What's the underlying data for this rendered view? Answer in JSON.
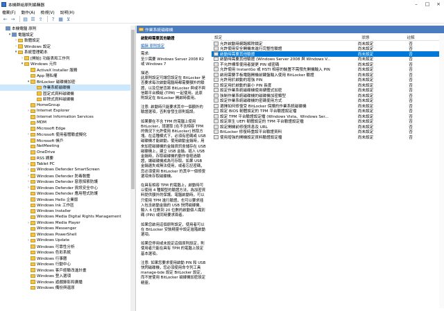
{
  "window": {
    "title": "本機群組原則編輯器"
  },
  "menu": [
    "檔案(F)",
    "動作(A)",
    "檢視(V)",
    "說明(H)"
  ],
  "tree": [
    {
      "label": "本機電腦 原則",
      "indent": 0,
      "icon": "root",
      "twist": ""
    },
    {
      "label": "電腦設定",
      "indent": 1,
      "icon": "root",
      "twist": "▾"
    },
    {
      "label": "軟體設定",
      "indent": 2,
      "icon": "folder",
      "twist": "›"
    },
    {
      "label": "Windows 設定",
      "indent": 2,
      "icon": "folder",
      "twist": "›"
    },
    {
      "label": "系統管理範本",
      "indent": 2,
      "icon": "folder",
      "twist": "▾"
    },
    {
      "label": "[開始] 功能表和工作列",
      "indent": 3,
      "icon": "folder",
      "twist": "›"
    },
    {
      "label": "Windows 元件",
      "indent": 3,
      "icon": "folder",
      "twist": "▾"
    },
    {
      "label": "ActiveX Installer 服務",
      "indent": 4,
      "icon": "folder",
      "twist": ""
    },
    {
      "label": "App 隱私權",
      "indent": 4,
      "icon": "folder",
      "twist": ""
    },
    {
      "label": "BitLocker 磁碟機加密",
      "indent": 4,
      "icon": "folder",
      "twist": "▾"
    },
    {
      "label": "作業系統磁碟機",
      "indent": 5,
      "icon": "folder",
      "twist": "",
      "selected": true
    },
    {
      "label": "固定式資料磁碟機",
      "indent": 5,
      "icon": "folder",
      "twist": ""
    },
    {
      "label": "卸除式資料磁碟機",
      "indent": 5,
      "icon": "folder",
      "twist": ""
    },
    {
      "label": "HomeGroup",
      "indent": 4,
      "icon": "folder",
      "twist": ""
    },
    {
      "label": "Internet Explorer",
      "indent": 4,
      "icon": "folder",
      "twist": "›"
    },
    {
      "label": "Internet Information Services",
      "indent": 4,
      "icon": "folder",
      "twist": ""
    },
    {
      "label": "MDM",
      "indent": 4,
      "icon": "folder",
      "twist": ""
    },
    {
      "label": "Microsoft Edge",
      "indent": 4,
      "icon": "folder",
      "twist": ""
    },
    {
      "label": "Microsoft 使用者體驗虛擬化",
      "indent": 4,
      "icon": "folder",
      "twist": "›"
    },
    {
      "label": "Microsoft 帳戶",
      "indent": 4,
      "icon": "folder",
      "twist": ""
    },
    {
      "label": "NetMeeting",
      "indent": 4,
      "icon": "folder",
      "twist": ""
    },
    {
      "label": "OneDrive",
      "indent": 4,
      "icon": "folder",
      "twist": ""
    },
    {
      "label": "RSS 摘要",
      "indent": 4,
      "icon": "folder",
      "twist": ""
    },
    {
      "label": "Tablet PC",
      "indent": 4,
      "icon": "folder",
      "twist": "›"
    },
    {
      "label": "Windows Defender SmartScreen",
      "indent": 4,
      "icon": "folder",
      "twist": "›"
    },
    {
      "label": "Windows Defender 防毒軟體",
      "indent": 4,
      "icon": "folder",
      "twist": "›"
    },
    {
      "label": "Windows Defender 惡意探索防護",
      "indent": 4,
      "icon": "folder",
      "twist": "›"
    },
    {
      "label": "Windows Defender 資訊安全中心",
      "indent": 4,
      "icon": "folder",
      "twist": "›"
    },
    {
      "label": "Windows Defender 應用程式防護",
      "indent": 4,
      "icon": "folder",
      "twist": ""
    },
    {
      "label": "Windows Hello 企業版",
      "indent": 4,
      "icon": "folder",
      "twist": ""
    },
    {
      "label": "Windows Ink 工作區",
      "indent": 4,
      "icon": "folder",
      "twist": ""
    },
    {
      "label": "Windows Installer",
      "indent": 4,
      "icon": "folder",
      "twist": ""
    },
    {
      "label": "Windows Media Digital Rights Management",
      "indent": 4,
      "icon": "folder",
      "twist": ""
    },
    {
      "label": "Windows Media Player",
      "indent": 4,
      "icon": "folder",
      "twist": "›"
    },
    {
      "label": "Windows Messenger",
      "indent": 4,
      "icon": "folder",
      "twist": ""
    },
    {
      "label": "Windows PowerShell",
      "indent": 4,
      "icon": "folder",
      "twist": ""
    },
    {
      "label": "Windows Update",
      "indent": 4,
      "icon": "folder",
      "twist": "›"
    },
    {
      "label": "Windows 可靠性分析",
      "indent": 4,
      "icon": "folder",
      "twist": ""
    },
    {
      "label": "Windows 色彩系統",
      "indent": 4,
      "icon": "folder",
      "twist": ""
    },
    {
      "label": "Windows 行事曆",
      "indent": 4,
      "icon": "folder",
      "twist": ""
    },
    {
      "label": "Windows 行動中心",
      "indent": 4,
      "icon": "folder",
      "twist": ""
    },
    {
      "label": "Windows 客戶經驗改進計畫",
      "indent": 4,
      "icon": "folder",
      "twist": ""
    },
    {
      "label": "Windows 登入選項",
      "indent": 4,
      "icon": "folder",
      "twist": ""
    },
    {
      "label": "Windows 遊戲錄影和廣播",
      "indent": 4,
      "icon": "folder",
      "twist": ""
    },
    {
      "label": "Windows 備份與還原",
      "indent": 4,
      "icon": "folder",
      "twist": ""
    }
  ],
  "right_header": "作業系統磁碟機",
  "description": {
    "title": "啟動時需要其他驗證",
    "edit_link": "編輯 原則設定",
    "paragraphs": [
      "需求:\n至少需要 Windows Server 2008 R2 或 Windows 7",
      "描述:\n此原則設定可讓您設定在 BitLocker 是否要求每次啟動電腦時都需要額外的驗證，以及您是否將 BitLocker 與或不與信賴平台模組 (TPM) 一起使用。此原則設定在 BitLocker 開啟時套用。",
      "注意: 啟動時只能要求其中一個額外的驗證選項，否則會發生原則錯誤。",
      "如果要在不含 TPM 的電腦上使用 BitLocker，請選取 [在不含相容 TPM 的情況下允許使用 BitLocker] 核取方塊。在這種模式下，必須有密碼或 USB 磁碟機才能啟動。使用啟動金鑰時，用來加密磁碟機的金鑰資訊會儲存在 USB 磁碟機上，建立 USB 金鑰。插入 USB 金鑰時，存取磁碟機的動作會經過驗證，讓磁碟機成為可存取。如果 USB 金鑰遺失或無法使用，或者忘記密碼，您必須使用 BitLocker 的其中一個修復選項來存取磁碟機。",
      "在具有相容 TPM 的電腦上，啟動時可以使用 4 種類型的驗證方法，為加密資料提供額外的保護。電腦啟動時，可以只使用 TPM 進行驗證，也可以要求插入包含啟動金鑰的 USB 快閃磁碟機、輸入 6 位數到 20 位數的啟動個人識別碼 (PIN) 或同時要求兩者。",
      "如果您啟用這個原則設定，使用者可以在 BitLocker 安裝精靈中設定進階啟動選項。",
      "如果您停用或未設定這個原則設定，則使用者只能在具有 TPM 的電腦上設定基本選項。",
      "注意: 如果您要求使用啟動 PIN 和 USB 快閃磁碟機，您必須使用命令列工具 manage-bde 設定 BitLocker 設定，而不是使用 BitLocker 磁碟機加密設定精靈。"
    ]
  },
  "list": {
    "headers": {
      "setting": "設定",
      "state": "狀態",
      "comment": "註解"
    },
    "rows": [
      {
        "name": "允許啟動時網路解除鎖定",
        "state": "尚未設定",
        "comment": "否"
      },
      {
        "name": "允許使用安全開機來進行完整性驗證",
        "state": "尚未設定",
        "comment": "否"
      },
      {
        "name": "啟動時需要其他驗證",
        "state": "尚未設定",
        "comment": "否",
        "selected": true
      },
      {
        "name": "啟動時需要其他驗證 (Windows Server 2008 與 Windows V...",
        "state": "尚未設定",
        "comment": "否"
      },
      {
        "name": "不允許標準使用者變更 PIN 或密碼",
        "state": "尚未設定",
        "comment": "否"
      },
      {
        "name": "允許使用 InstantGo 或 HSTI 相容的裝置不需預先開機輸入 PIN",
        "state": "尚未設定",
        "comment": "否"
      },
      {
        "name": "啟用需要手板電腦開機前鍵盤輸入使用 BitLocker 驗證",
        "state": "尚未設定",
        "comment": "否"
      },
      {
        "name": "允許用於啟動的增強 PIN",
        "state": "尚未設定",
        "comment": "否"
      },
      {
        "name": "設定用於啟動的最小 PIN 長度",
        "state": "尚未設定",
        "comment": "否"
      },
      {
        "name": "設定作業系統磁碟機使用硬體式加密",
        "state": "尚未設定",
        "comment": "否"
      },
      {
        "name": "強制作業系統磁碟機的磁碟機加密類型",
        "state": "尚未設定",
        "comment": "否"
      },
      {
        "name": "設定作業系統磁碟機的密碼使用方式",
        "state": "尚未設定",
        "comment": "否"
      },
      {
        "name": "選擇如何修復受 BitLocker 保護的作業系統磁碟機",
        "state": "尚未設定",
        "comment": "否"
      },
      {
        "name": "設定 BIOS 韌體設定的 TPM 平台驗證設定檔",
        "state": "尚未設定",
        "comment": "否"
      },
      {
        "name": "設定 TPM 平台驗證設定檔 (Windows Vista、Windows Ser...",
        "state": "尚未設定",
        "comment": "否"
      },
      {
        "name": "設定原生 UEFI 韌體設定的 TPM 平台驗證設定檔",
        "state": "尚未設定",
        "comment": "否"
      },
      {
        "name": "設定開機前修復訊息及 URL",
        "state": "尚未設定",
        "comment": "否"
      },
      {
        "name": "BitLocker 修復時重設平台驗證資料",
        "state": "尚未設定",
        "comment": "否"
      },
      {
        "name": "使用增強的開機設定資料驗證設定檔",
        "state": "尚未設定",
        "comment": "否"
      }
    ]
  }
}
